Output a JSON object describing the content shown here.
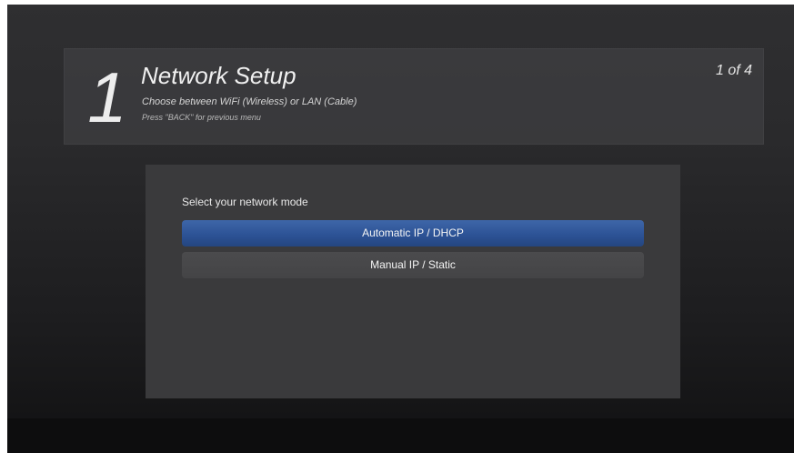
{
  "header": {
    "step_number": "1",
    "title": "Network Setup",
    "subtitle": "Choose between WiFi (Wireless) or LAN (Cable)",
    "hint": "Press \"BACK\" for previous menu",
    "page_indicator": "1 of 4"
  },
  "content": {
    "prompt": "Select your network mode",
    "options": [
      {
        "label": "Automatic IP / DHCP",
        "selected": true
      },
      {
        "label": "Manual IP / Static",
        "selected": false
      }
    ]
  },
  "colors": {
    "selected_option": "#2d5396",
    "unselected_option": "#444446",
    "panel_background": "#3a3a3c"
  }
}
